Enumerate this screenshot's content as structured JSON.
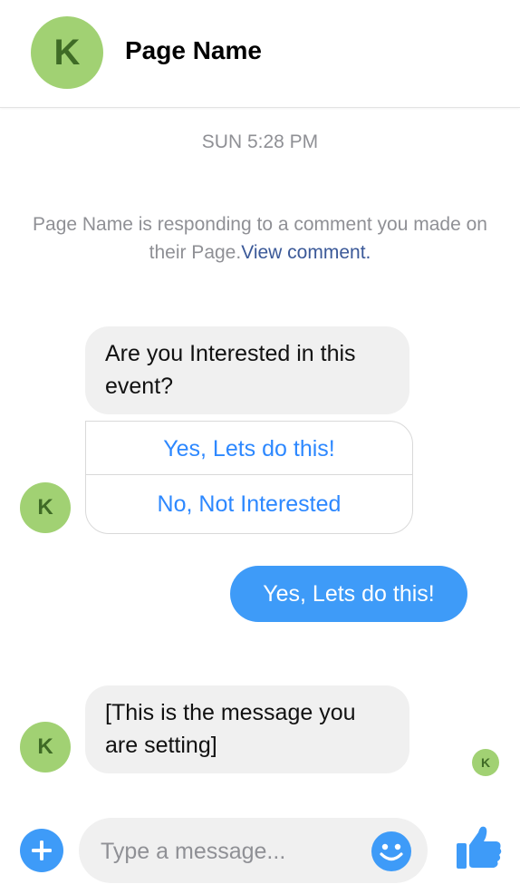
{
  "header": {
    "avatar_letter": "K",
    "title": "Page Name"
  },
  "timestamp": "SUN 5:28 PM",
  "notice": {
    "text": "Page Name is responding to a comment you made on their Page.",
    "link": "View comment."
  },
  "messages": {
    "question": {
      "line1": "Are you Interested in this",
      "line2": "event?"
    },
    "quick_replies": [
      "Yes, Lets do this!",
      "No, Not Interested"
    ],
    "sent": "Yes, Lets do this!",
    "custom": {
      "line1": "[This is the message you",
      "line2": "are setting]"
    },
    "avatar_letter": "K",
    "read_receipt_letter": "K"
  },
  "composer": {
    "placeholder": "Type a message..."
  },
  "icons": {
    "add": "plus-circle-icon",
    "emoji": "smiley-icon",
    "like": "thumbs-up-icon"
  },
  "colors": {
    "accent": "#3e9bf8",
    "avatar": "#a1d173",
    "avatar_text": "#3f6b26",
    "bubble": "#f0f0f0",
    "link": "#3b5998"
  }
}
